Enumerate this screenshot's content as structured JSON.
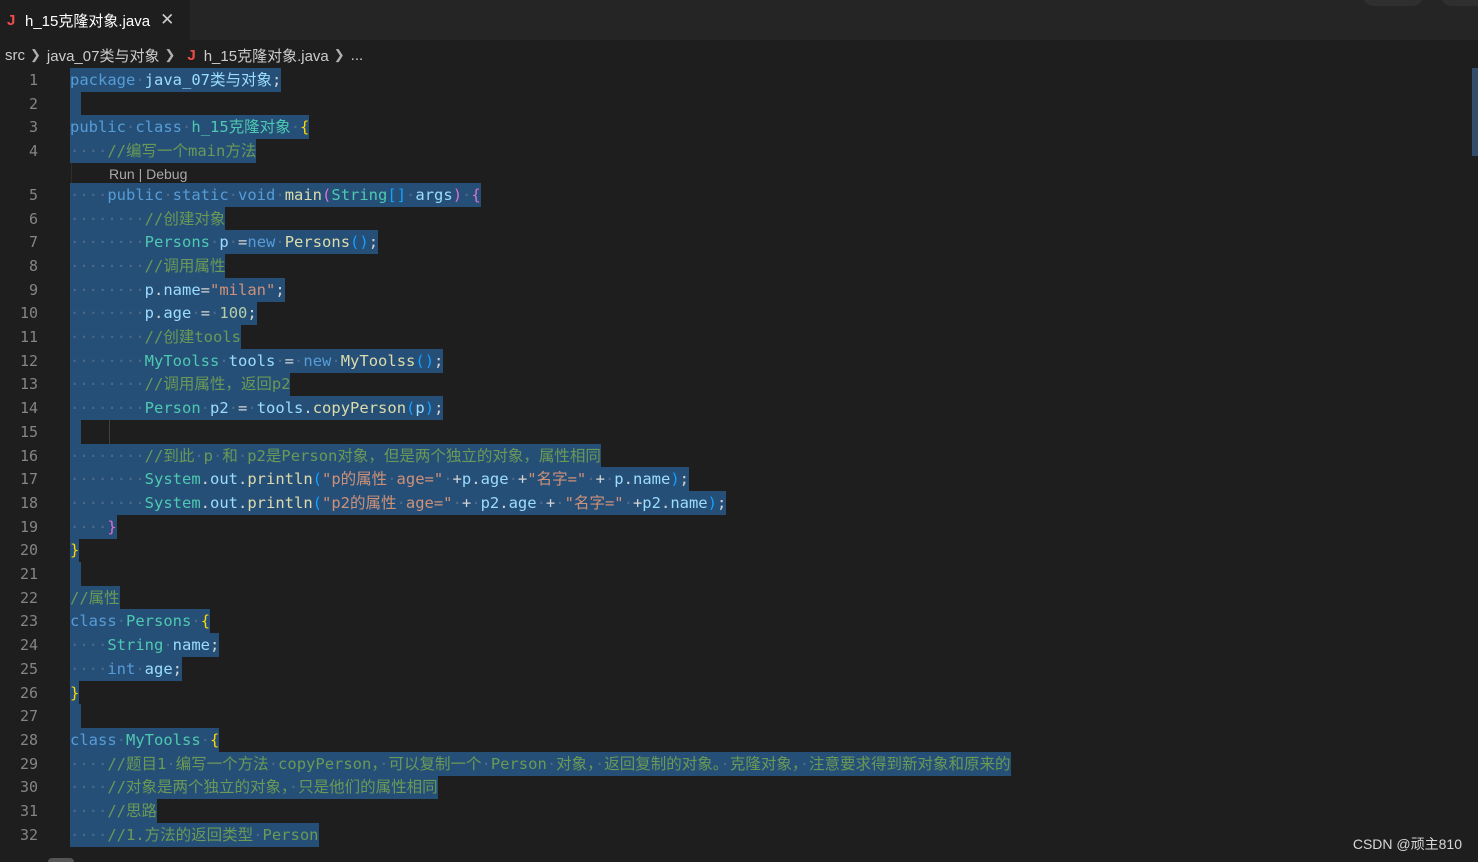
{
  "tab": {
    "icon": "J",
    "label": "h_15克隆对象.java",
    "close": "✕"
  },
  "breadcrumb": {
    "items": [
      "src",
      "java_07类与对象",
      "h_15克隆对象.java",
      "..."
    ],
    "java_icon": "J"
  },
  "codelens": "Run | Debug",
  "lines": [
    {
      "n": "1",
      "html": "<span class='k'>package</span><span class='ws'>·</span><span class='v'>java_07类与对象</span>;"
    },
    {
      "n": "2",
      "html": ""
    },
    {
      "n": "3",
      "html": "<span class='k'>public</span><span class='ws'>·</span><span class='k'>class</span><span class='ws'>·</span><span class='t'>h_15克隆对象</span><span class='ws'>·</span><span class='b'>{</span>"
    },
    {
      "n": "4",
      "html": "<span class='ws'>····</span><span class='c'>//编写一个main方法</span>"
    },
    {
      "n": "5",
      "html": "<span class='ws'>····</span><span class='k'>public</span><span class='ws'>·</span><span class='k'>static</span><span class='ws'>·</span><span class='k'>void</span><span class='ws'>·</span><span class='f'>main</span><span class='b2'>(</span><span class='t'>String</span><span class='b3'>[]</span><span class='ws'>·</span><span class='v'>args</span><span class='b2'>)</span><span class='ws'>·</span><span class='b2'>{</span>"
    },
    {
      "n": "6",
      "html": "<span class='ws'>········</span><span class='c'>//创建对象</span>"
    },
    {
      "n": "7",
      "html": "<span class='ws'>········</span><span class='t'>Persons</span><span class='ws'>·</span><span class='v'>p</span><span class='ws'>·</span>=<span class='k'>new</span><span class='ws'>·</span><span class='f'>Persons</span><span class='b3'>()</span>;"
    },
    {
      "n": "8",
      "html": "<span class='ws'>········</span><span class='c'>//调用属性</span>"
    },
    {
      "n": "9",
      "html": "<span class='ws'>········</span><span class='v'>p</span>.<span class='v'>name</span>=<span class='s'>\"milan\"</span>;"
    },
    {
      "n": "10",
      "html": "<span class='ws'>········</span><span class='v'>p</span>.<span class='v'>age</span><span class='ws'>·</span>=<span class='ws'>·</span><span class='n'>100</span>;"
    },
    {
      "n": "11",
      "html": "<span class='ws'>········</span><span class='c'>//创建tools</span>"
    },
    {
      "n": "12",
      "html": "<span class='ws'>········</span><span class='t'>MyToolss</span><span class='ws'>·</span><span class='v'>tools</span><span class='ws'>·</span>=<span class='ws'>·</span><span class='k'>new</span><span class='ws'>·</span><span class='f'>MyToolss</span><span class='b3'>()</span>;"
    },
    {
      "n": "13",
      "html": "<span class='ws'>········</span><span class='c'>//调用属性，返回p2</span>"
    },
    {
      "n": "14",
      "html": "<span class='ws'>········</span><span class='t'>Person</span><span class='ws'>·</span><span class='v'>p2</span><span class='ws'>·</span>=<span class='ws'>·</span><span class='v'>tools</span>.<span class='f'>copyPerson</span><span class='b3'>(</span><span class='v'>p</span><span class='b3'>)</span>;"
    },
    {
      "n": "15",
      "html": ""
    },
    {
      "n": "16",
      "html": "<span class='ws'>········</span><span class='c'>//到此<span class='ws'>·</span>p<span class='ws'>·</span>和<span class='ws'>·</span>p2是Person对象，但是两个独立的对象，属性相同</span>"
    },
    {
      "n": "17",
      "html": "<span class='ws'>········</span><span class='t'>System</span>.<span class='v'>out</span>.<span class='f'>println</span><span class='b3'>(</span><span class='s'>\"p的属性<span class='ws'>·</span>age=\"</span><span class='ws'>·</span>+<span class='v'>p</span>.<span class='v'>age</span><span class='ws'>·</span>+<span class='s'>\"名字=\"</span><span class='ws'>·</span>+<span class='ws'>·</span><span class='v'>p</span>.<span class='v'>name</span><span class='b3'>)</span>;"
    },
    {
      "n": "18",
      "html": "<span class='ws'>········</span><span class='t'>System</span>.<span class='v'>out</span>.<span class='f'>println</span><span class='b3'>(</span><span class='s'>\"p2的属性<span class='ws'>·</span>age=\"</span><span class='ws'>·</span>+<span class='ws'>·</span><span class='v'>p2</span>.<span class='v'>age</span><span class='ws'>·</span>+<span class='ws'>·</span><span class='s'>\"名字=\"</span><span class='ws'>·</span>+<span class='v'>p2</span>.<span class='v'>name</span><span class='b3'>)</span>;"
    },
    {
      "n": "19",
      "html": "<span class='ws'>····</span><span class='b2'>}</span>"
    },
    {
      "n": "20",
      "html": "<span class='b'>}</span>"
    },
    {
      "n": "21",
      "html": ""
    },
    {
      "n": "22",
      "html": "<span class='c'>//属性</span>"
    },
    {
      "n": "23",
      "html": "<span class='k'>class</span><span class='ws'>·</span><span class='t'>Persons</span><span class='ws'>·</span><span class='b'>{</span>"
    },
    {
      "n": "24",
      "html": "<span class='ws'>····</span><span class='t'>String</span><span class='ws'>·</span><span class='v'>name</span>;"
    },
    {
      "n": "25",
      "html": "<span class='ws'>····</span><span class='k'>int</span><span class='ws'>·</span><span class='v'>age</span>;"
    },
    {
      "n": "26",
      "html": "<span class='b'>}</span>"
    },
    {
      "n": "27",
      "html": ""
    },
    {
      "n": "28",
      "html": "<span class='k'>class</span><span class='ws'>·</span><span class='t'>MyToolss</span><span class='ws'>·</span><span class='b'>{</span>"
    },
    {
      "n": "29",
      "html": "<span class='ws'>····</span><span class='c'>//题目1<span class='ws'>·</span>编写一个方法<span class='ws'>·</span>copyPerson，<span class='ws'>·</span>可以复制一个<span class='ws'>·</span>Person<span class='ws'>·</span>对象，<span class='ws'>·</span>返回复制的对象。<span class='ws'>·</span>克隆对象，<span class='ws'>·</span>注意要求得到新对象和原来的</span>"
    },
    {
      "n": "30",
      "html": "<span class='ws'>····</span><span class='c'>//对象是两个独立的对象，<span class='ws'>·</span>只是他们的属性相同</span>"
    },
    {
      "n": "31",
      "html": "<span class='ws'>····</span><span class='c'>//思路</span>"
    },
    {
      "n": "32",
      "html": "<span class='ws'>····</span><span class='c'>//1.方法的返回类型<span class='ws'>·</span>Person</span>"
    }
  ],
  "watermark": "CSDN @顽主810"
}
